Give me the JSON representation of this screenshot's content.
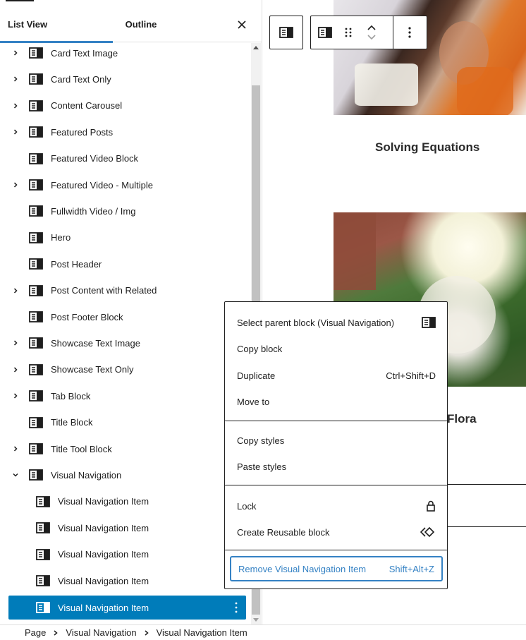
{
  "tabs": {
    "list_view": "List View",
    "outline": "Outline",
    "close_icon": "close-icon"
  },
  "tree": {
    "items": [
      {
        "label": "Card Text Image",
        "expandable": true,
        "expanded": false
      },
      {
        "label": "Card Text Only",
        "expandable": true,
        "expanded": false
      },
      {
        "label": "Content Carousel",
        "expandable": true,
        "expanded": false
      },
      {
        "label": "Featured Posts",
        "expandable": true,
        "expanded": false
      },
      {
        "label": "Featured Video Block",
        "expandable": false
      },
      {
        "label": "Featured Video - Multiple",
        "expandable": true,
        "expanded": false
      },
      {
        "label": "Fullwidth Video / Img",
        "expandable": false
      },
      {
        "label": "Hero",
        "expandable": false
      },
      {
        "label": "Post Header",
        "expandable": false
      },
      {
        "label": "Post Content with Related",
        "expandable": true,
        "expanded": false
      },
      {
        "label": "Post Footer Block",
        "expandable": false
      },
      {
        "label": "Showcase Text Image",
        "expandable": true,
        "expanded": false
      },
      {
        "label": "Showcase Text Only",
        "expandable": true,
        "expanded": false
      },
      {
        "label": "Tab Block",
        "expandable": true,
        "expanded": false
      },
      {
        "label": "Title Block",
        "expandable": false
      },
      {
        "label": "Title Tool Block",
        "expandable": true,
        "expanded": false
      },
      {
        "label": "Visual Navigation",
        "expandable": true,
        "expanded": true
      }
    ],
    "children": [
      {
        "label": "Visual Navigation Item",
        "selected": false
      },
      {
        "label": "Visual Navigation Item",
        "selected": false
      },
      {
        "label": "Visual Navigation Item",
        "selected": false
      },
      {
        "label": "Visual Navigation Item",
        "selected": false
      },
      {
        "label": "Visual Navigation Item",
        "selected": true
      }
    ]
  },
  "canvas": {
    "card1_title": "Solving Equations",
    "card2_title": "Flora"
  },
  "context_menu": {
    "groups": [
      [
        {
          "label": "Select parent block (Visual Navigation)",
          "icon": "block-icon"
        },
        {
          "label": "Copy block"
        },
        {
          "label": "Duplicate",
          "shortcut": "Ctrl+Shift+D"
        },
        {
          "label": "Move to"
        }
      ],
      [
        {
          "label": "Copy styles"
        },
        {
          "label": "Paste styles"
        }
      ],
      [
        {
          "label": "Lock",
          "icon": "lock-icon"
        },
        {
          "label": "Create Reusable block",
          "icon": "reusable-icon"
        }
      ],
      [
        {
          "label": "Remove Visual Navigation Item",
          "shortcut": "Shift+Alt+Z",
          "danger": true
        }
      ]
    ]
  },
  "breadcrumb": [
    "Page",
    "Visual Navigation",
    "Visual Navigation Item"
  ],
  "colors": {
    "accent": "#007cba",
    "focus": "#3582c4",
    "text": "#1e1e1e"
  }
}
